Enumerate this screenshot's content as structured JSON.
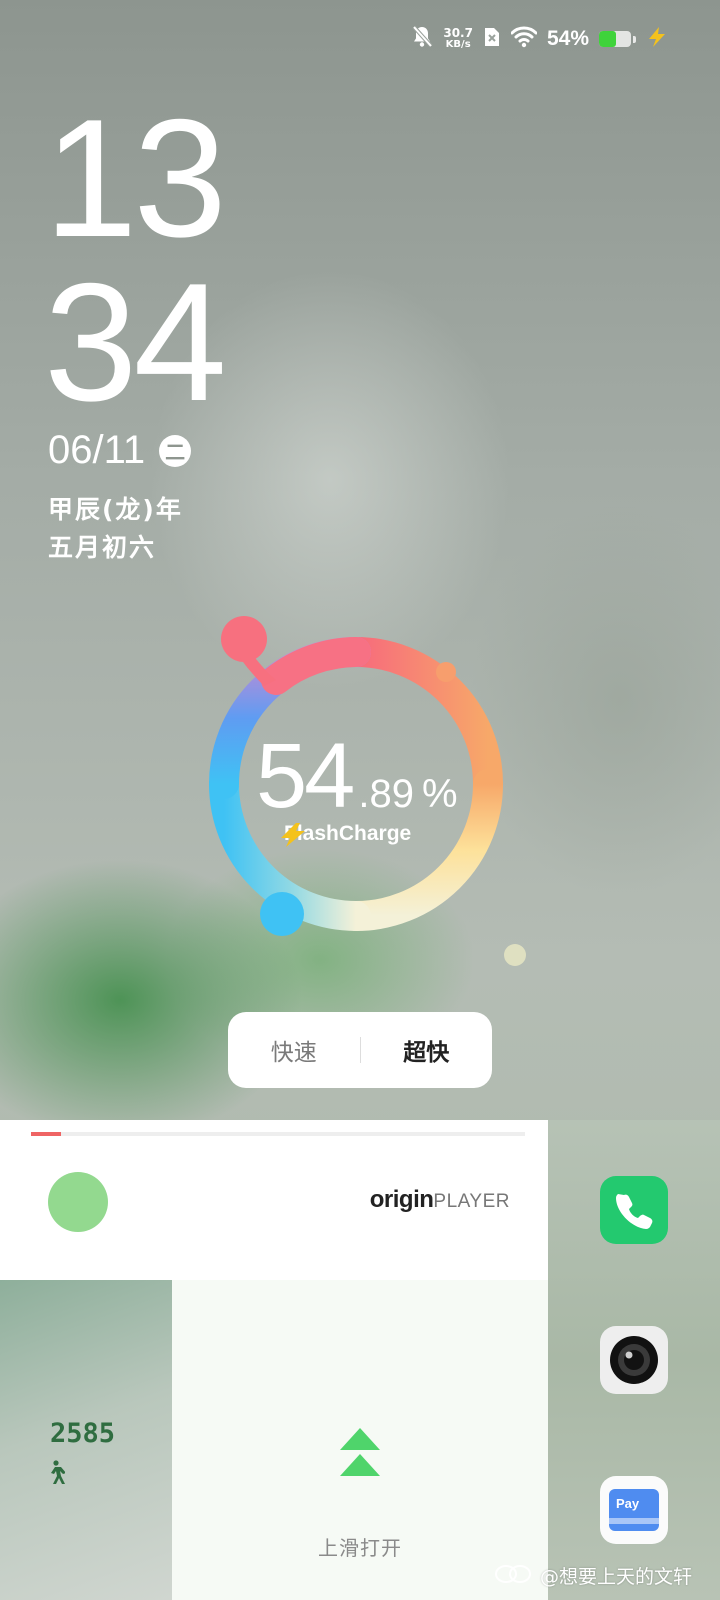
{
  "status_bar": {
    "net_speed_value": "30.7",
    "net_speed_unit": "KB/s",
    "battery_percent_text": "54%",
    "battery_level": 0.54,
    "icons": [
      "mute-bell-icon",
      "sim-off-icon",
      "wifi-icon",
      "battery-icon",
      "charging-bolt-icon"
    ]
  },
  "lockscreen": {
    "hour": "13",
    "minute": "34",
    "date": "06/11",
    "weekday": "二",
    "lunar_year": "甲辰(龙)年",
    "lunar_day": "五月初六"
  },
  "charging": {
    "percent_int": "54",
    "percent_decimal": ".89",
    "percent_unit": "%",
    "percent_value": 54.89,
    "brand": "FlashCharge"
  },
  "charge_mode": {
    "options": [
      {
        "label": "快速",
        "selected": false
      },
      {
        "label": "超快",
        "selected": true
      }
    ]
  },
  "music_widget": {
    "progress": 0.06,
    "logo_bold": "origin",
    "logo_light": "PLAYER"
  },
  "steps_widget": {
    "count": "2585",
    "icon": "walking-icon"
  },
  "swipe": {
    "label": "上滑打开",
    "icon": "double-chevron-up-icon"
  },
  "dock": {
    "apps": [
      "phone-app-icon",
      "camera-app-icon",
      "pay-app-icon"
    ],
    "pay_label": "Pay"
  },
  "watermark": {
    "text": "@想要上天的文轩"
  },
  "colors": {
    "accent_green": "#23c96f",
    "progress_red": "#ef6464",
    "charge_bolt": "#f4c21c",
    "step_green": "#2f6d40"
  }
}
